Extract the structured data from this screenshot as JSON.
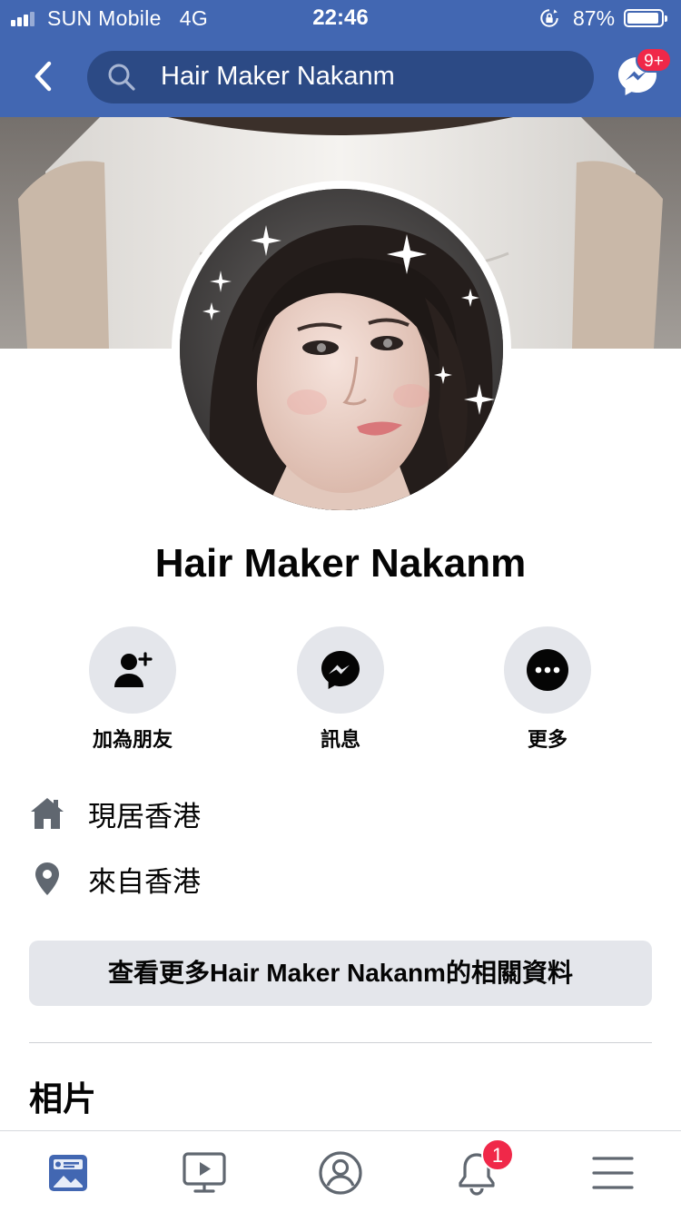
{
  "status_bar": {
    "carrier": "SUN Mobile",
    "network": "4G",
    "time": "22:46",
    "battery": "87%",
    "battery_level": 0.87,
    "signal_bars": 3
  },
  "nav": {
    "search_text": "Hair Maker Nakanm",
    "messenger_badge": "9+"
  },
  "profile": {
    "name": "Hair Maker Nakanm"
  },
  "actions": [
    {
      "label": "加為朋友",
      "icon": "add-friend-icon"
    },
    {
      "label": "訊息",
      "icon": "messenger-icon"
    },
    {
      "label": "更多",
      "icon": "more-icon"
    }
  ],
  "info": {
    "lives_in": "現居香港",
    "from": "來自香港"
  },
  "more_info_button": "查看更多Hair Maker Nakanm的相關資料",
  "photos_heading": "相片",
  "tab_bar": {
    "tabs": [
      "news-feed-icon",
      "watch-icon",
      "profile-icon",
      "notifications-icon",
      "menu-icon"
    ],
    "notifications_badge": "1",
    "active_tab": "news-feed-icon"
  },
  "colors": {
    "brand_blue": "#4267b2",
    "search_bg": "#2c4a85",
    "badge_red": "#f02849",
    "button_grey": "#e4e6eb",
    "icon_grey": "#606770"
  }
}
